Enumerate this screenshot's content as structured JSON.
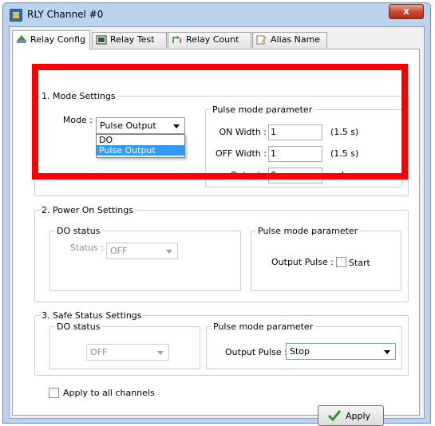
{
  "window": {
    "title": "RLY Channel #0",
    "close_glyph": "x"
  },
  "tabs": [
    {
      "label": "Relay Config",
      "icon": "relay-config-icon",
      "active": true
    },
    {
      "label": "Relay Test",
      "icon": "relay-test-icon"
    },
    {
      "label": "Relay Count",
      "icon": "relay-count-icon"
    },
    {
      "label": "Alias Name",
      "icon": "alias-name-icon"
    }
  ],
  "mode_settings": {
    "legend": "1. Mode Settings",
    "mode_label": "Mode :",
    "mode_value": "Pulse Output",
    "mode_options": [
      "DO",
      "Pulse Output"
    ],
    "pulse": {
      "legend": "Pulse mode parameter",
      "on_width_label": "ON Width :",
      "on_width_value": "1",
      "on_width_unit": "(1.5 s)",
      "off_width_label": "OFF Width :",
      "off_width_value": "1",
      "off_width_unit": "(1.5 s)",
      "output_label": "Output :",
      "output_value": "0",
      "output_unit": "pulses"
    }
  },
  "power_on": {
    "legend": "2. Power On Settings",
    "do_status": {
      "legend": "DO status",
      "status_label": "Status :",
      "status_value": "OFF"
    },
    "pulse": {
      "legend": "Pulse mode parameter",
      "output_pulse_label": "Output Pulse :",
      "start_label": "Start"
    }
  },
  "safe_status": {
    "legend": "3. Safe Status Settings",
    "do_status": {
      "legend": "DO status",
      "status_value": "OFF"
    },
    "pulse": {
      "legend": "Pulse mode parameter",
      "output_pulse_label": "Output Pulse :",
      "output_pulse_value": "Stop"
    }
  },
  "apply_all_label": "Apply to all channels",
  "apply_button_label": "Apply",
  "colors": {
    "highlight": "#ff0000",
    "selection": "#3399ff",
    "apply_check": "#2a9d1f"
  }
}
